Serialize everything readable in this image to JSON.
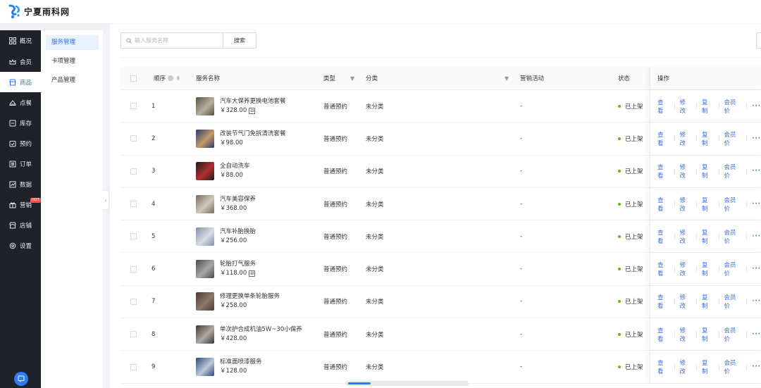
{
  "brand": {
    "name": "宁夏雨科网"
  },
  "nav": {
    "items": [
      {
        "label": "概况",
        "icon": "grid-icon"
      },
      {
        "label": "会员",
        "icon": "crown-icon"
      },
      {
        "label": "商品",
        "icon": "store-icon",
        "active": true
      },
      {
        "label": "点餐",
        "icon": "dish-icon"
      },
      {
        "label": "库存",
        "icon": "box-icon"
      },
      {
        "label": "预约",
        "icon": "calendar-check-icon"
      },
      {
        "label": "订单",
        "icon": "list-icon"
      },
      {
        "label": "数据",
        "icon": "chart-icon"
      },
      {
        "label": "营销",
        "icon": "gift-icon",
        "badge": "HOT"
      },
      {
        "label": "店铺",
        "icon": "shop-icon"
      },
      {
        "label": "设置",
        "icon": "gear-icon"
      }
    ]
  },
  "subnav": {
    "items": [
      {
        "label": "服务管理",
        "active": true
      },
      {
        "label": "卡项管理"
      },
      {
        "label": "产品管理"
      }
    ]
  },
  "search": {
    "placeholder": "输入服务名称",
    "button_label": "搜索"
  },
  "table": {
    "headers": {
      "order": "顺序",
      "name": "服务名称",
      "type": "类型",
      "category": "分类",
      "promo": "营销活动",
      "status": "状态",
      "ops": "操作"
    },
    "ops_labels": {
      "view": "查看",
      "edit": "修改",
      "copy": "复制",
      "member_price": "会员价",
      "more": "···"
    },
    "rows": [
      {
        "order": "1",
        "name": "汽车大保养更换电池套餐",
        "price": "￥328.00",
        "coupon": true,
        "type": "普通预约",
        "category": "未分类",
        "promo": "-",
        "status": "已上架",
        "thumb": [
          "#5a5040",
          "#b8b0a0"
        ]
      },
      {
        "order": "2",
        "name": "改装节气门免拆清洗套餐",
        "price": "￥98.00",
        "coupon": false,
        "type": "普通预约",
        "category": "未分类",
        "promo": "-",
        "status": "已上架",
        "thumb": [
          "#2b3a6b",
          "#c49a6c"
        ]
      },
      {
        "order": "3",
        "name": "全自动洗车",
        "price": "￥88.00",
        "coupon": false,
        "type": "普通预约",
        "category": "未分类",
        "promo": "-",
        "status": "已上架",
        "thumb": [
          "#1c1c1c",
          "#b03030"
        ]
      },
      {
        "order": "4",
        "name": "汽车美容保养",
        "price": "￥368.00",
        "coupon": false,
        "type": "普通预约",
        "category": "未分类",
        "promo": "-",
        "status": "已上架",
        "thumb": [
          "#7a6a5a",
          "#d0c8bc"
        ]
      },
      {
        "order": "5",
        "name": "汽车补胎换胎",
        "price": "￥256.00",
        "coupon": false,
        "type": "普通预约",
        "category": "未分类",
        "promo": "-",
        "status": "已上架",
        "thumb": [
          "#8090a8",
          "#d8dde5"
        ]
      },
      {
        "order": "6",
        "name": "轮胎打气服务",
        "price": "￥118.00",
        "coupon": true,
        "type": "普通预约",
        "category": "未分类",
        "promo": "-",
        "status": "已上架",
        "thumb": [
          "#4a4a4a",
          "#a8a8a8"
        ]
      },
      {
        "order": "7",
        "name": "修理更换单条轮胎服务",
        "price": "￥258.00",
        "coupon": false,
        "type": "普通预约",
        "category": "未分类",
        "promo": "-",
        "status": "已上架",
        "thumb": [
          "#4a3a30",
          "#8a7a6a"
        ]
      },
      {
        "order": "8",
        "name": "单次护合成机油5W~30小保养",
        "price": "￥428.00",
        "coupon": false,
        "type": "普通预约",
        "category": "未分类",
        "promo": "-",
        "status": "已上架",
        "thumb": [
          "#3a3a3a",
          "#b0a8a0"
        ]
      },
      {
        "order": "9",
        "name": "标准面喷漆服务",
        "price": "￥128.00",
        "coupon": false,
        "type": "普通预约",
        "category": "未分类",
        "promo": "-",
        "status": "已上架",
        "thumb": [
          "#2a4a7a",
          "#c0c8d8"
        ]
      }
    ]
  },
  "colors": {
    "accent": "#3b6ee8",
    "sidebar": "#1f2329",
    "status_online": "#52c41a",
    "hot_badge": "#ff4d4f"
  }
}
